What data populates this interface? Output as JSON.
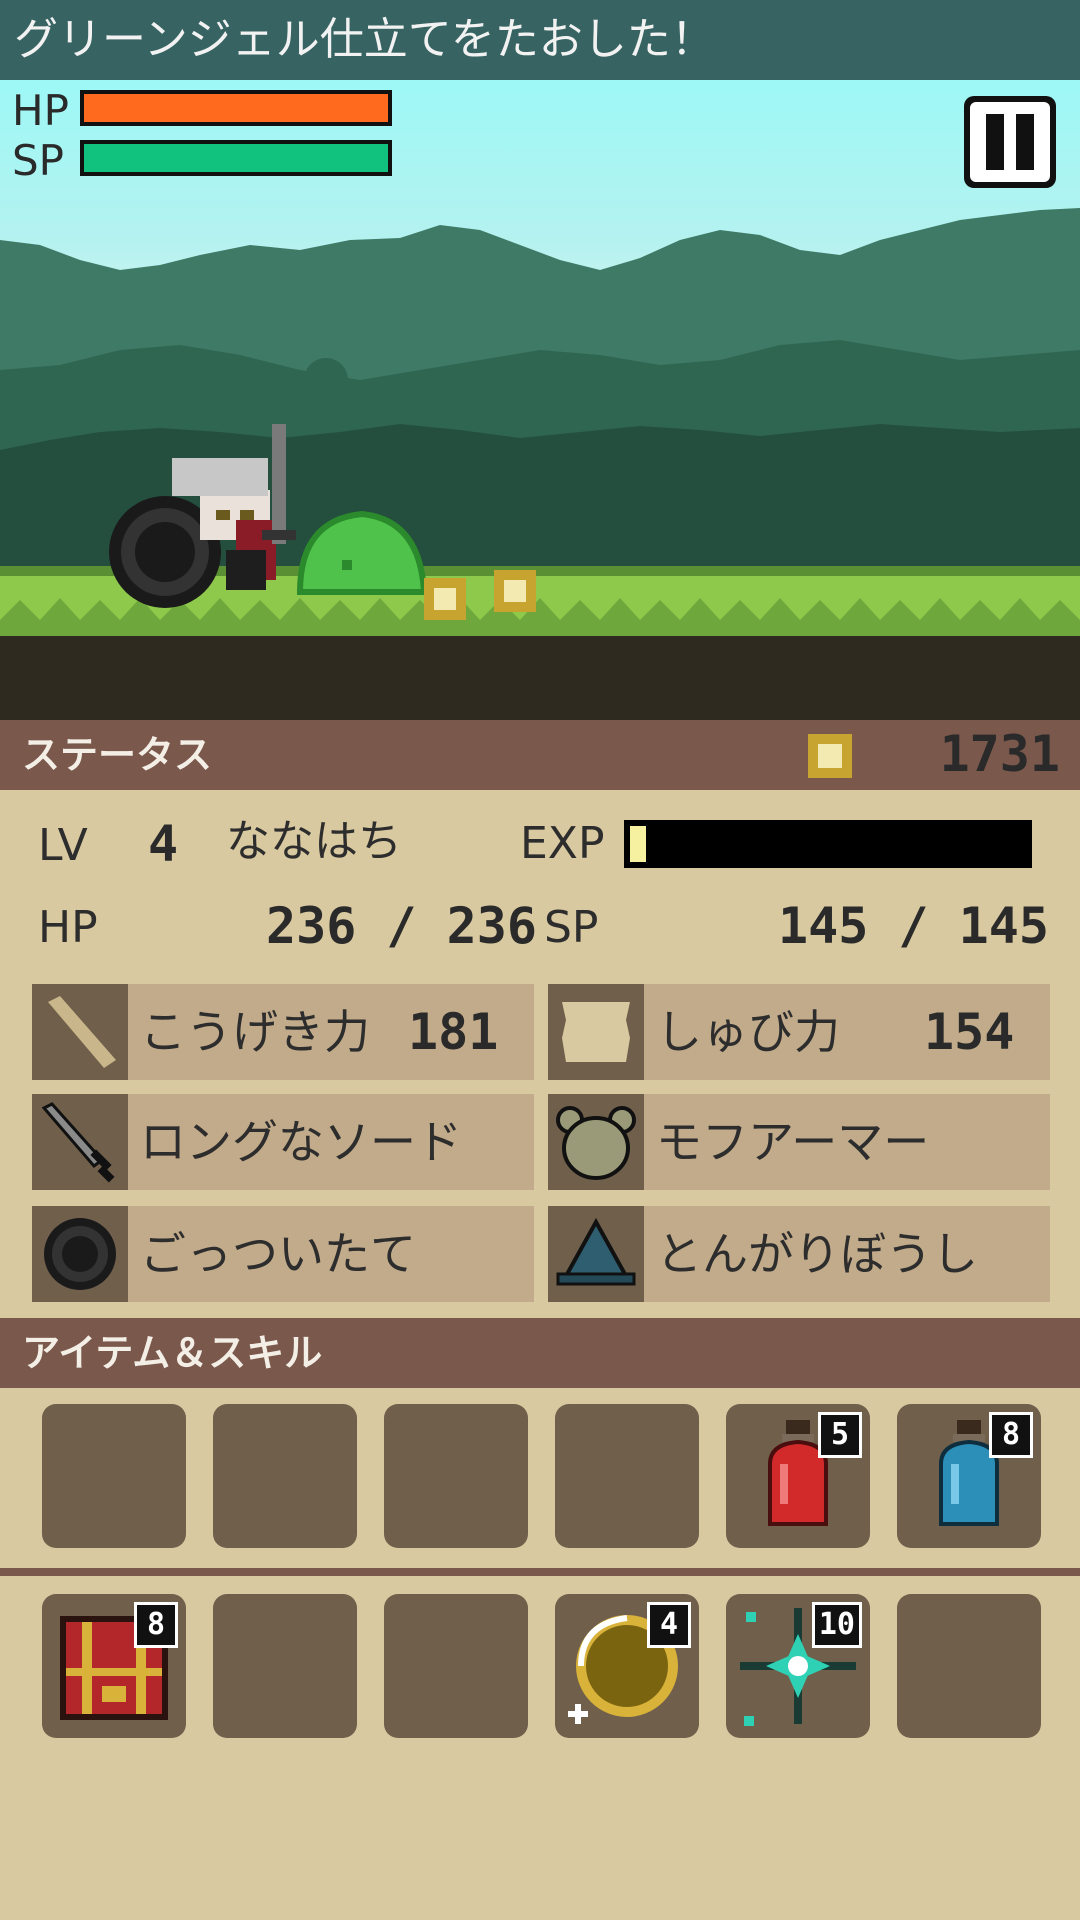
{
  "message": "グリーンジェル仕立てをたおした！",
  "battle": {
    "hp_label": "HP",
    "sp_label": "SP",
    "hp_fraction": 1.0,
    "sp_fraction": 1.0,
    "hp_color": "#ff6a1e",
    "sp_color": "#11c27e"
  },
  "pause_icon": "pause-icon",
  "status": {
    "header": "ステータス",
    "gold": "1731",
    "lv_label": "LV",
    "lv_value": "4",
    "name": "ななはち",
    "exp_label": "EXP",
    "exp_fraction": 0.04,
    "hp_label": "HP",
    "hp_value": "236 / 236",
    "sp_label": "SP",
    "sp_value": "145 / 145",
    "attack_label": "こうげき力",
    "attack_value": "181",
    "defense_label": "しゅび力",
    "defense_value": "154"
  },
  "equipment": {
    "weapon": "ロングなソード",
    "armor": "モフアーマー",
    "shield": "ごっついたて",
    "helmet": "とんがりぼうし"
  },
  "items": {
    "header": "アイテム＆スキル",
    "row1": [
      {
        "icon": "",
        "count": ""
      },
      {
        "icon": "",
        "count": ""
      },
      {
        "icon": "",
        "count": ""
      },
      {
        "icon": "",
        "count": ""
      },
      {
        "icon": "red-potion-icon",
        "count": "5"
      },
      {
        "icon": "blue-potion-icon",
        "count": "8"
      }
    ],
    "row2": [
      {
        "icon": "treasure-chest-icon",
        "count": "8"
      },
      {
        "icon": "",
        "count": ""
      },
      {
        "icon": "",
        "count": ""
      },
      {
        "icon": "gold-coin-icon",
        "count": "4"
      },
      {
        "icon": "sparkle-icon",
        "count": "10"
      },
      {
        "icon": "",
        "count": ""
      }
    ]
  }
}
